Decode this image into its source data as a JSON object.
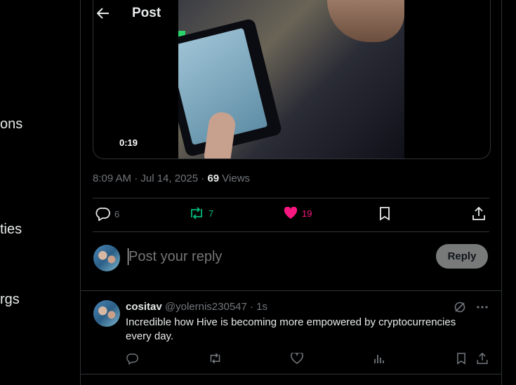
{
  "nav": {
    "fragments": [
      "ons",
      "ties",
      "rgs"
    ]
  },
  "header": {
    "title": "Post"
  },
  "media": {
    "duration": "0:19"
  },
  "post_meta": {
    "time": "8:09 AM · Jul 14, 2025 · ",
    "views_count": "69",
    "views_label": " Views"
  },
  "actions": {
    "replies": "6",
    "reposts": "7",
    "likes": "19"
  },
  "compose": {
    "placeholder": "Post your reply",
    "reply_label": "Reply"
  },
  "reply_tweet": {
    "name": "cositav",
    "handle": "@yolernis230547",
    "time": " · 1s",
    "text": "Incredible how Hive is becoming more empowered by cryptocurrencies every day."
  },
  "colors": {
    "repost": "#00ba7c",
    "like": "#f91880",
    "muted": "#71767b"
  }
}
